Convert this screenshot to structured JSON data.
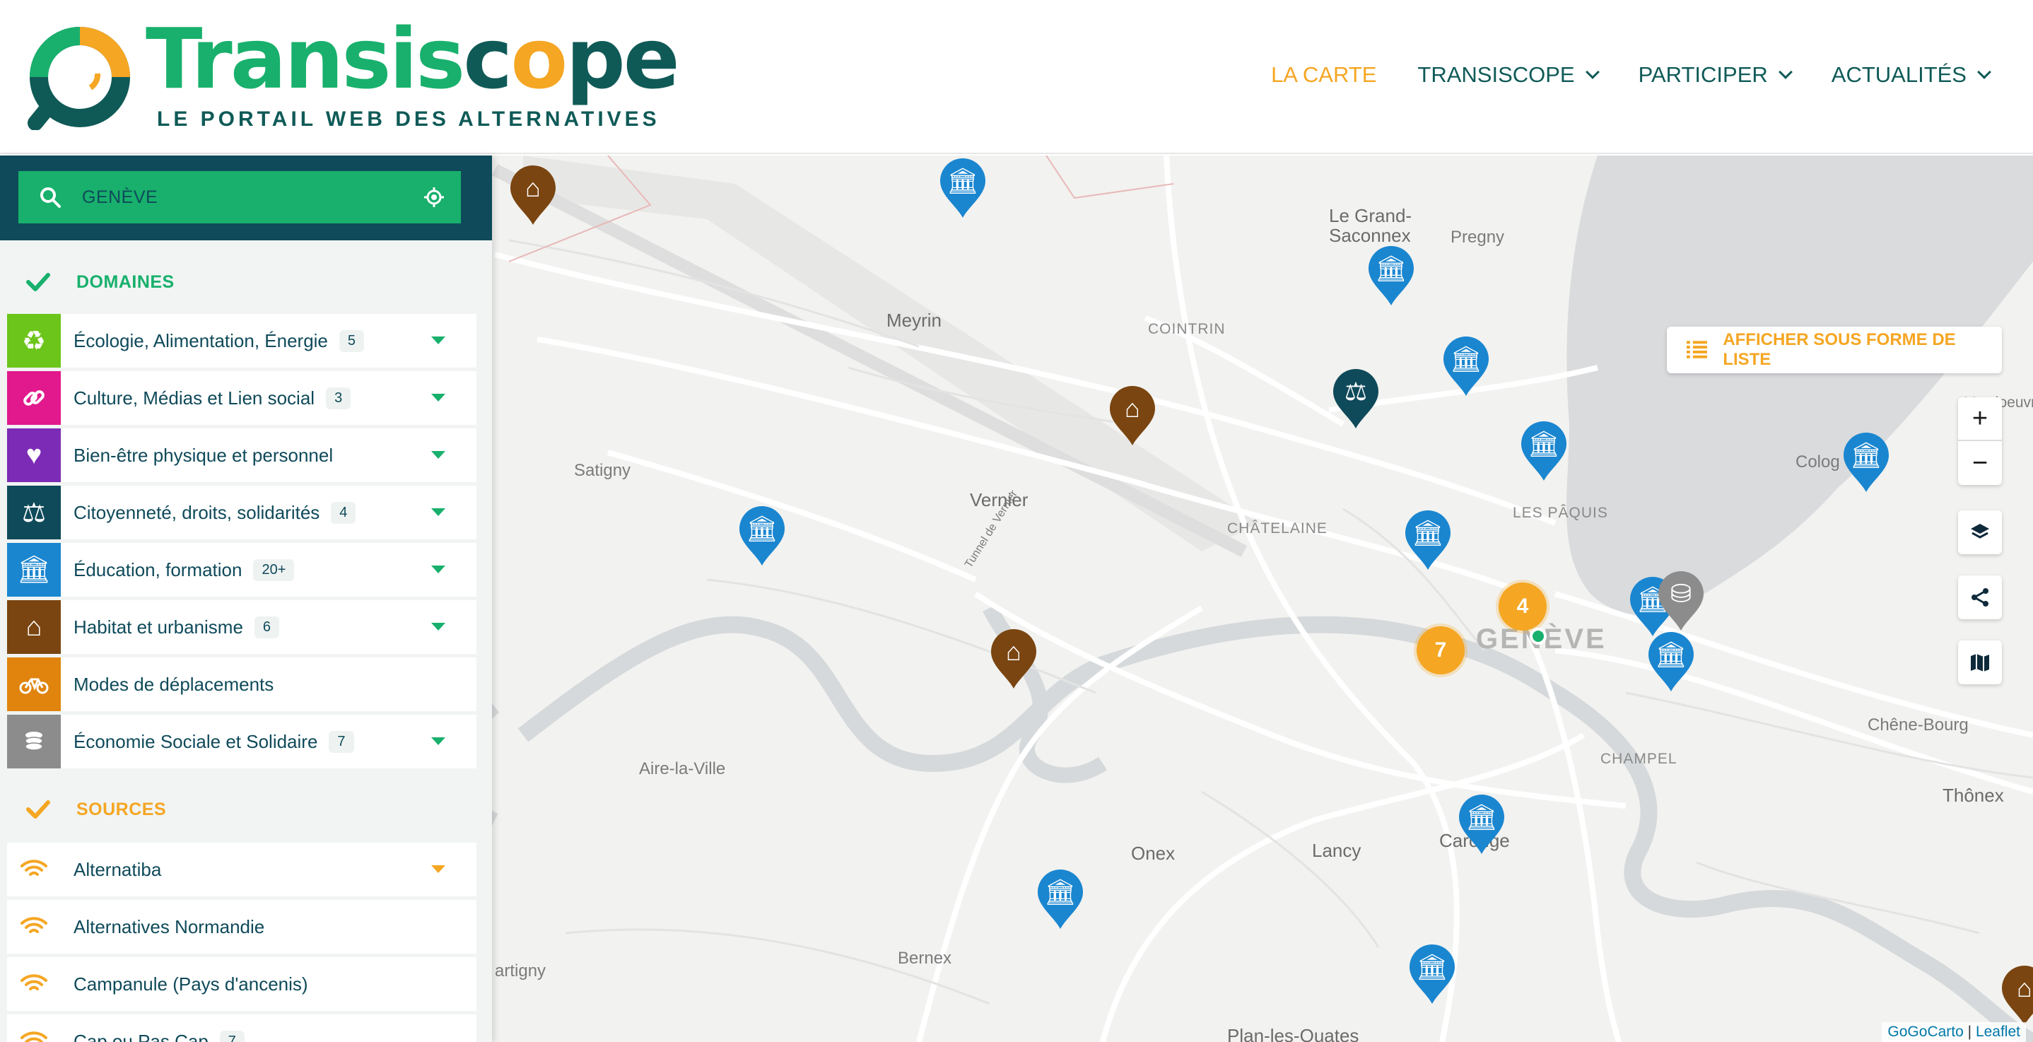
{
  "header": {
    "logo_word": {
      "p1": "Transis",
      "p2": "c",
      "p3": "o",
      "p4": "pe"
    },
    "logo_tagline": "LE PORTAIL WEB DES ALTERNATIVES",
    "nav": [
      {
        "label": "LA CARTE",
        "active": true
      },
      {
        "label": "TRANSISCOPE",
        "dropdown": true
      },
      {
        "label": "PARTICIPER",
        "dropdown": true
      },
      {
        "label": "ACTUALITÉS",
        "dropdown": true
      }
    ]
  },
  "sidebar": {
    "search": {
      "value": "GENÈVE",
      "icon": "search-icon",
      "locate_icon": "crosshair-icon"
    },
    "domains": {
      "title": "DOMAINES",
      "items": [
        {
          "label": "Écologie, Alimentation, Énergie",
          "count": "5",
          "color": "#6cc51a",
          "icon": "recycle-icon"
        },
        {
          "label": "Culture, Médias et Lien social",
          "count": "3",
          "color": "#e1198c",
          "icon": "link-icon"
        },
        {
          "label": "Bien-être physique et personnel",
          "count": "",
          "color": "#7b2bb5",
          "icon": "heart-icon"
        },
        {
          "label": "Citoyenneté, droits, solidarités",
          "count": "4",
          "color": "#0f4a5a",
          "icon": "scales-icon"
        },
        {
          "label": "Éducation, formation",
          "count": "20+",
          "color": "#1a86d0",
          "icon": "institution-icon"
        },
        {
          "label": "Habitat et urbanisme",
          "count": "6",
          "color": "#7a4510",
          "icon": "house-icon"
        },
        {
          "label": "Modes de déplacements",
          "count": "",
          "color": "#e0840d",
          "icon": "bicycle-icon"
        },
        {
          "label": "Économie Sociale et Solidaire",
          "count": "7",
          "color": "#8c8c8c",
          "icon": "coins-icon"
        }
      ]
    },
    "sources": {
      "title": "SOURCES",
      "items": [
        {
          "label": "Alternatiba",
          "count": ""
        },
        {
          "label": "Alternatives Normandie",
          "count": ""
        },
        {
          "label": "Campanule (Pays d'ancenis)",
          "count": ""
        },
        {
          "label": "Cap ou Pas Cap",
          "count": "7"
        }
      ]
    }
  },
  "map": {
    "list_toggle": "AFFICHER SOUS FORME DE LISTE",
    "zoom_in": "+",
    "zoom_out": "−",
    "places": {
      "le_grand": "Le Grand-",
      "saconnex": "Saconnex",
      "pregny": "Pregny",
      "meyrin": "Meyrin",
      "cointrin": "COINTRIN",
      "satigny": "Satigny",
      "vernier": "Vernier",
      "tunnel": "Tunnel de Vernier",
      "chatelaine": "CHÂTELAINE",
      "les_paquis": "LES PÂQUIS",
      "geneve": "GENÈVE",
      "cologny": "Colog",
      "vandoeuvres": "Vandoeuvr",
      "chene_bourg": "Chêne-Bourg",
      "champel": "CHAMPEL",
      "aire_la_ville": "Aire-la-Ville",
      "onex": "Onex",
      "lancy": "Lancy",
      "carouge": "Carouge",
      "thonex": "Thônex",
      "bernex": "Bernex",
      "artigny": "artigny",
      "plan_les_ouates": "Plan-les-Ouates"
    },
    "clusters": [
      "4",
      "7"
    ],
    "attribution": {
      "gogocarto": "GoGoCarto",
      "sep": " | ",
      "leaflet": "Leaflet"
    }
  }
}
